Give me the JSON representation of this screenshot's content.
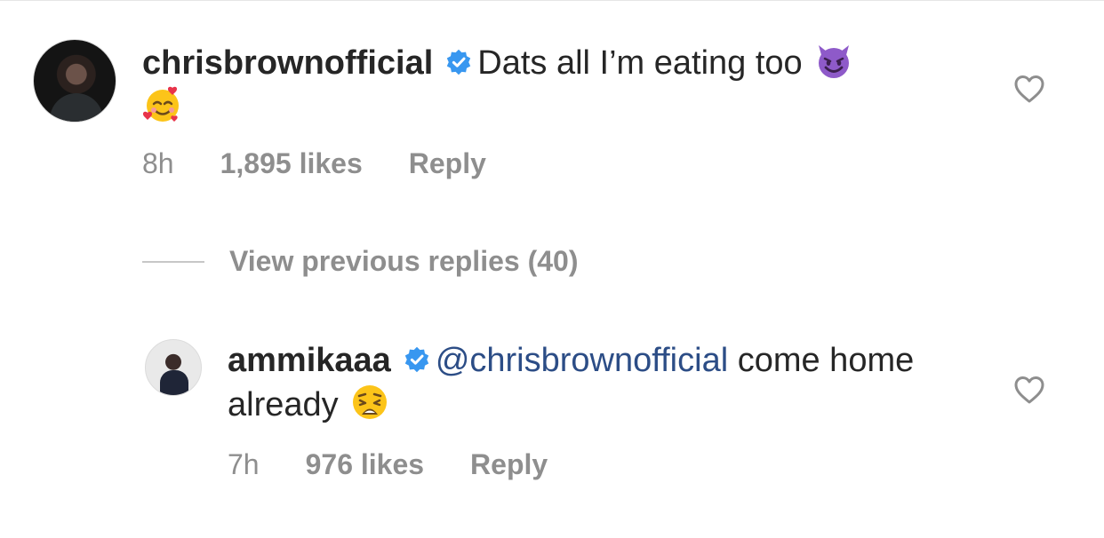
{
  "comments": [
    {
      "username": "chrisbrownofficial",
      "verified": true,
      "text": "Dats all I’m eating too",
      "emojis": [
        "smiling-face-with-horns-emoji",
        "smiling-face-with-hearts-emoji"
      ],
      "time": "8h",
      "likes": "1,895 likes",
      "reply_label": "Reply"
    },
    {
      "username": "ammikaaa",
      "verified": true,
      "mention": "@chrisbrownofficial",
      "text": "come home already",
      "emojis": [
        "weary-face-emoji"
      ],
      "time": "7h",
      "likes": "976 likes",
      "reply_label": "Reply"
    }
  ],
  "view_previous_replies": "View previous replies (40)",
  "colors": {
    "text": "#262626",
    "meta": "#8e8e8e",
    "mention": "#2c4d86",
    "verified": "#3897f0",
    "devil": "#8e5ac9"
  }
}
